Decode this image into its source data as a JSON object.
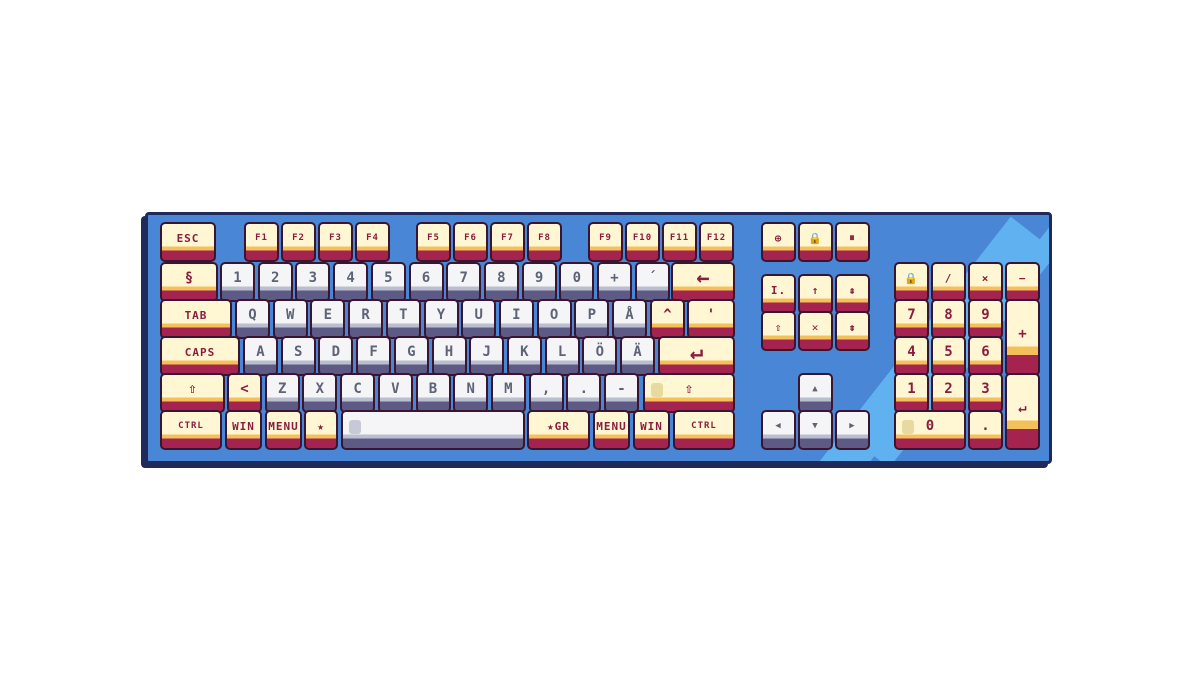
{
  "keyboard": {
    "function_row": {
      "esc": "ESC",
      "f_keys": [
        "F1",
        "F2",
        "F3",
        "F4",
        "F5",
        "F6",
        "F7",
        "F8",
        "F9",
        "F10",
        "F11",
        "F12"
      ],
      "system_keys": [
        "⊕",
        "🔒",
        "⏸"
      ]
    },
    "number_row": {
      "start": "§",
      "keys": [
        "1",
        "2",
        "3",
        "4",
        "5",
        "6",
        "7",
        "8",
        "9",
        "0",
        "+",
        "´"
      ],
      "backspace": "←"
    },
    "qwerty_row": {
      "tab": "TAB",
      "keys": [
        "Q",
        "W",
        "E",
        "R",
        "T",
        "Y",
        "U",
        "I",
        "O",
        "P",
        "Å",
        "^"
      ],
      "end": "'"
    },
    "home_row": {
      "caps": "CAPS",
      "keys": [
        "A",
        "S",
        "D",
        "F",
        "G",
        "H",
        "J",
        "K",
        "L",
        "Ö",
        "Ä"
      ],
      "enter": "↵"
    },
    "shift_row": {
      "left_shift": "⇧",
      "keys": [
        "<",
        "Z",
        "X",
        "C",
        "V",
        "B",
        "N",
        "M",
        ",",
        ".",
        "-"
      ],
      "right_shift": "⇧"
    },
    "bottom_row": {
      "left": [
        "CTRL",
        "WIN",
        "MENU",
        "★"
      ],
      "space": "",
      "right": [
        "★GR",
        "MENU",
        "WIN",
        "CTRL"
      ]
    },
    "nav_cluster": {
      "row1": [
        "I.",
        "↑",
        "⇞"
      ],
      "row2": [
        "⇧",
        "✕",
        "⇟"
      ]
    },
    "arrows": {
      "up": "▲",
      "left": "◀",
      "down": "▼",
      "right": "▶"
    },
    "numpad": {
      "row1": [
        "🔒",
        "/",
        "×",
        "−"
      ],
      "row2": [
        "7",
        "8",
        "9"
      ],
      "row3": [
        "4",
        "5",
        "6"
      ],
      "row4": [
        "1",
        "2",
        "3"
      ],
      "zero": "0",
      "dot": ".",
      "plus": "+",
      "enter": "↵"
    }
  },
  "colors": {
    "case": "#4a86d6",
    "case_shine": "#5fb1f0",
    "outline": "#1f2a5a",
    "cream_key": "#fff7d4",
    "grey_key": "#f5f5f7",
    "legend_red": "#8a1d3e"
  }
}
